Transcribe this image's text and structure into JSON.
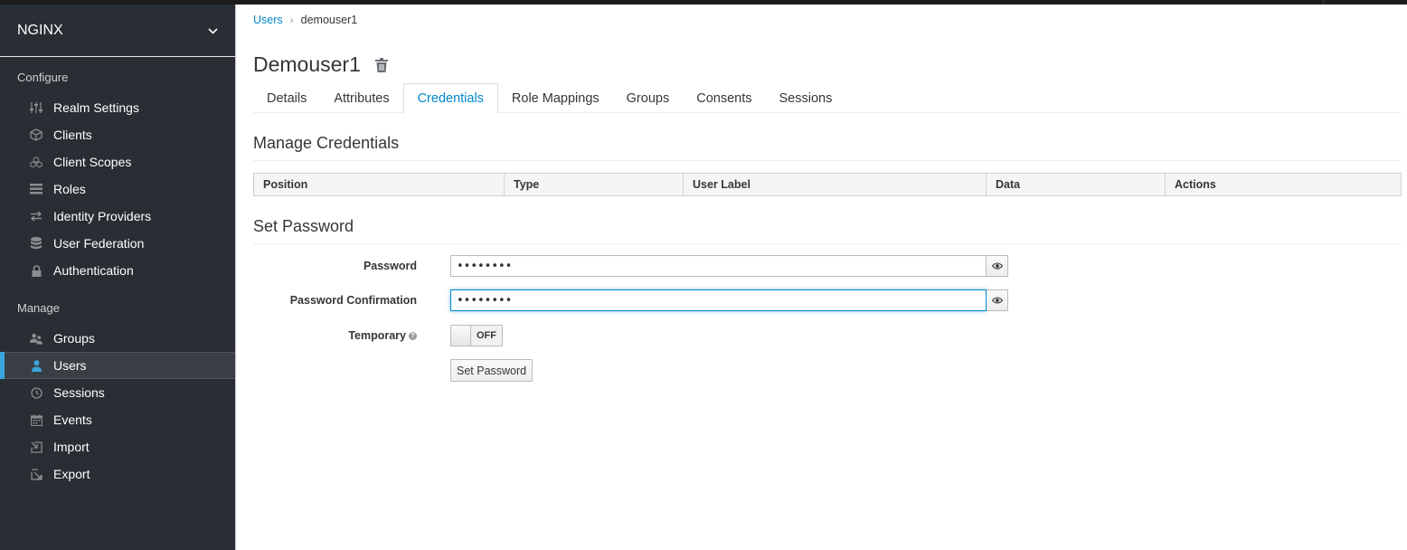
{
  "realm": {
    "name": "NGINX"
  },
  "sidebar": {
    "configure_title": "Configure",
    "configure_items": [
      {
        "label": "Realm Settings",
        "icon": "sliders-icon"
      },
      {
        "label": "Clients",
        "icon": "cube-icon"
      },
      {
        "label": "Client Scopes",
        "icon": "cubes-icon"
      },
      {
        "label": "Roles",
        "icon": "list-icon"
      },
      {
        "label": "Identity Providers",
        "icon": "exchange-icon"
      },
      {
        "label": "User Federation",
        "icon": "database-icon"
      },
      {
        "label": "Authentication",
        "icon": "lock-icon"
      }
    ],
    "manage_title": "Manage",
    "manage_items": [
      {
        "label": "Groups",
        "icon": "users-icon"
      },
      {
        "label": "Users",
        "icon": "user-icon",
        "active": true
      },
      {
        "label": "Sessions",
        "icon": "clock-icon"
      },
      {
        "label": "Events",
        "icon": "calendar-icon"
      },
      {
        "label": "Import",
        "icon": "import-icon"
      },
      {
        "label": "Export",
        "icon": "export-icon"
      }
    ]
  },
  "breadcrumb": {
    "parent": "Users",
    "current": "demouser1"
  },
  "page": {
    "title": "Demouser1"
  },
  "tabs": [
    "Details",
    "Attributes",
    "Credentials",
    "Role Mappings",
    "Groups",
    "Consents",
    "Sessions"
  ],
  "active_tab": "Credentials",
  "manage_credentials": {
    "title": "Manage Credentials",
    "columns": [
      "Position",
      "Type",
      "User Label",
      "Data",
      "Actions"
    ]
  },
  "set_password": {
    "title": "Set Password",
    "password_label": "Password",
    "password_value": "••••••••",
    "confirm_label": "Password Confirmation",
    "confirm_value": "••••••••",
    "temporary_label": "Temporary",
    "temporary_state": "OFF",
    "button_label": "Set Password"
  },
  "colors": {
    "accent": "#0088ce",
    "sidebar_bg": "#292e34",
    "active_bar": "#39a5dc"
  }
}
